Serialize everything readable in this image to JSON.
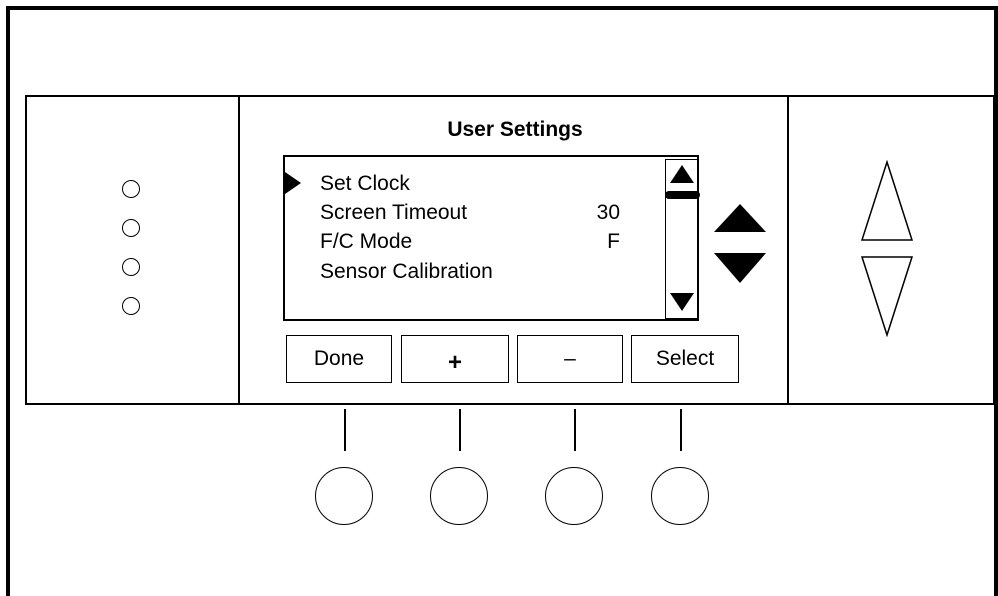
{
  "screen": {
    "title": "User Settings",
    "menu_items": [
      {
        "label": "Set Clock",
        "value": "",
        "selected": true
      },
      {
        "label": "Screen Timeout",
        "value": "30",
        "selected": false
      },
      {
        "label": "F/C Mode",
        "value": "F",
        "selected": false
      },
      {
        "label": "Sensor Calibration",
        "value": "",
        "selected": false
      }
    ]
  },
  "softkeys": {
    "done": "Done",
    "plus": "+",
    "minus": "–",
    "select": "Select"
  },
  "colors": {
    "line": "#000000",
    "background": "#ffffff"
  },
  "icons": [
    "indicator-led-icon",
    "selection-arrow-icon",
    "scroll-up-icon",
    "scroll-down-icon",
    "nav-up-icon",
    "nav-down-icon",
    "outline-up-arrow-icon",
    "outline-down-arrow-icon"
  ]
}
